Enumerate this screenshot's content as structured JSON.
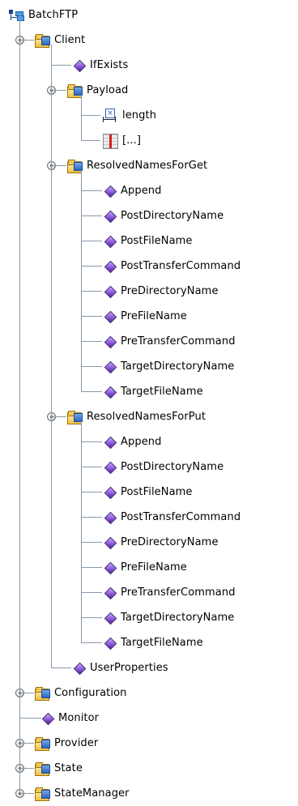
{
  "tree": {
    "root": {
      "label": "BatchFTP",
      "icon": "tree-root-icon"
    },
    "client": {
      "label": "Client",
      "icon": "folder-icon",
      "if_exists": "IfExists",
      "payload": {
        "label": "Payload",
        "length": "length",
        "array": "[...]"
      },
      "resolved_get": {
        "label": "ResolvedNamesForGet",
        "items": [
          "Append",
          "PostDirectoryName",
          "PostFileName",
          "PostTransferCommand",
          "PreDirectoryName",
          "PreFileName",
          "PreTransferCommand",
          "TargetDirectoryName",
          "TargetFileName"
        ]
      },
      "resolved_put": {
        "label": "ResolvedNamesForPut",
        "items": [
          "Append",
          "PostDirectoryName",
          "PostFileName",
          "PostTransferCommand",
          "PreDirectoryName",
          "PreFileName",
          "PreTransferCommand",
          "TargetDirectoryName",
          "TargetFileName"
        ]
      },
      "user_properties": "UserProperties"
    },
    "configuration": "Configuration",
    "monitor": "Monitor",
    "provider": "Provider",
    "state": "State",
    "state_manager": "StateManager"
  },
  "colors": {
    "tree_line": "#8a9aa8",
    "diamond": "#8b5ad8",
    "folder": "#f0c040",
    "folder_badge": "#2e65c1",
    "background": "#ffffff"
  }
}
